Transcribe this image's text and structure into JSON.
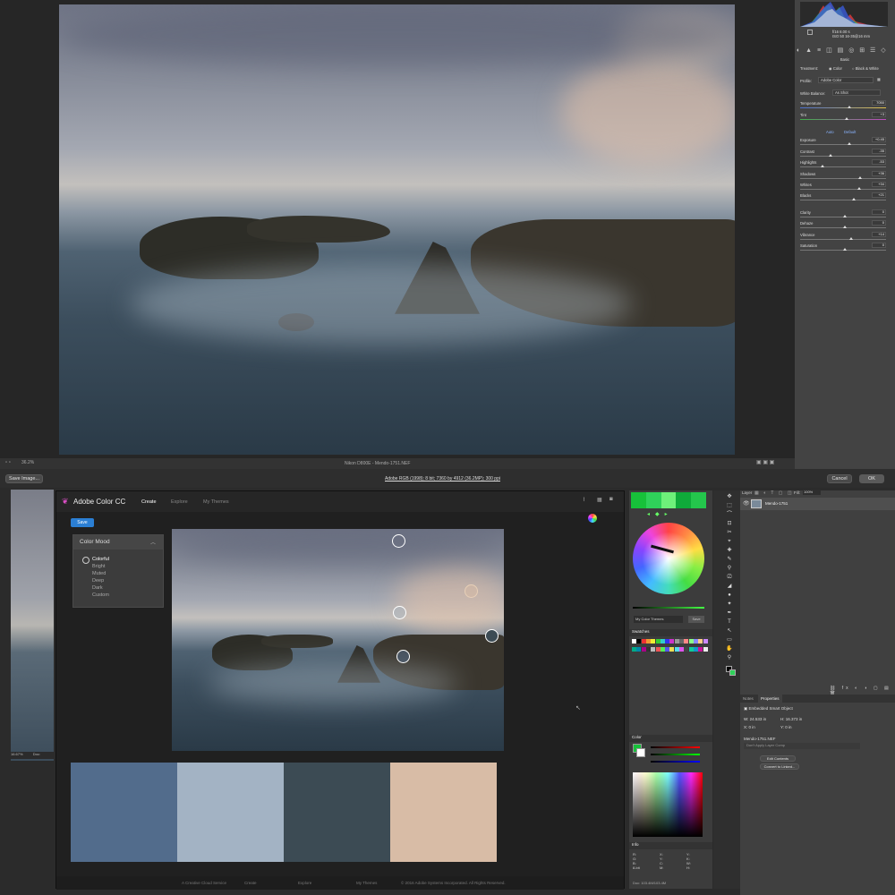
{
  "camera_raw": {
    "zoom": "36.2%",
    "file_info": "Nikon D800E  -  Mendo-1751.NEF",
    "workflow_link": "Adobe RGB (1998); 8 bit; 7360 by 4912 (36.2MP); 300 ppi",
    "save_button": "Save Image...",
    "cancel_button": "Cancel",
    "ok_button": "OK",
    "camera_info": [
      "f/16   8.00 s",
      "ISO 50   16-35@16 mm"
    ],
    "panel_title": "Basic",
    "treatment_label": "Treatment:",
    "treatment_color": "Color",
    "treatment_bw": "Black & White",
    "profile_label": "Profile:",
    "profile_value": "Adobe Color",
    "wb_label": "White Balance:",
    "wb_value": "As Shot",
    "auto_label": "Auto",
    "default_label": "Default",
    "sliders": [
      {
        "label": "Temperature",
        "value": "7050",
        "pos": 0.55
      },
      {
        "label": "Tint",
        "value": "+3",
        "pos": 0.52
      },
      {
        "label": "Exposure",
        "value": "+0.45",
        "pos": 0.55
      },
      {
        "label": "Contrast",
        "value": "-35",
        "pos": 0.33
      },
      {
        "label": "Highlights",
        "value": "-53",
        "pos": 0.24
      },
      {
        "label": "Shadows",
        "value": "+36",
        "pos": 0.68
      },
      {
        "label": "Whites",
        "value": "+34",
        "pos": 0.67
      },
      {
        "label": "Blacks",
        "value": "+21",
        "pos": 0.6
      },
      {
        "label": "Clarity",
        "value": "0",
        "pos": 0.5
      },
      {
        "label": "Dehaze",
        "value": "0",
        "pos": 0.5
      },
      {
        "label": "Vibrance",
        "value": "+14",
        "pos": 0.57
      },
      {
        "label": "Saturation",
        "value": "0",
        "pos": 0.5
      }
    ]
  },
  "photoshop": {
    "left_zoom": "16.67%",
    "left_doc": "Doc:",
    "swatches_title": "Swatches",
    "color_title": "Color",
    "info_title": "Info",
    "library_label": "My Color Themes",
    "library_btn": "Save",
    "info_values": [
      "R:",
      "G:",
      "B:",
      "8-bit",
      "X:",
      "Y:",
      "C:",
      "M:",
      "Y:",
      "K:",
      "W:",
      "H:"
    ],
    "doc_size": "Doc: 103.4M/103.4M",
    "layers": {
      "kind_label": "Layer",
      "fill_label": "Fill:",
      "opacity_label": "100%",
      "layer_name": "Mendo-1751"
    },
    "properties": {
      "tab_notes": "Notes",
      "tab_properties": "Properties",
      "object_type": "Embedded Smart Object",
      "w_value": "W: 24.533 in",
      "h_value": "H: 16.373 in",
      "x_value": "X: 0 in",
      "y_value": "Y: 0 in",
      "filename": "Mendo-1751.NEF",
      "comp_placeholder": "Don't Apply Layer Comp",
      "edit_button": "Edit Contents",
      "convert_button": "Convert to Linked..."
    }
  },
  "adobe_color": {
    "title": "Adobe Color CC",
    "tabs": [
      "Create",
      "Explore",
      "My Themes"
    ],
    "save_button": "Save",
    "mood_title": "Color Mood",
    "moods": [
      "Colorful",
      "Bright",
      "Muted",
      "Deep",
      "Dark",
      "Custom"
    ],
    "selected_mood": "Colorful",
    "swatches": [
      "#526c8c",
      "#a3b3c4",
      "#3c4b54",
      "#d8bca6"
    ],
    "footer": [
      "A Creative Cloud Service",
      "Create",
      "Explore",
      "My Themes",
      "© 2016 Adobe Systems Incorporated. All Rights Reserved."
    ]
  },
  "colors": {
    "accent": "#2b7fd4",
    "panel": "#3c3c3c",
    "dark": "#202020"
  }
}
